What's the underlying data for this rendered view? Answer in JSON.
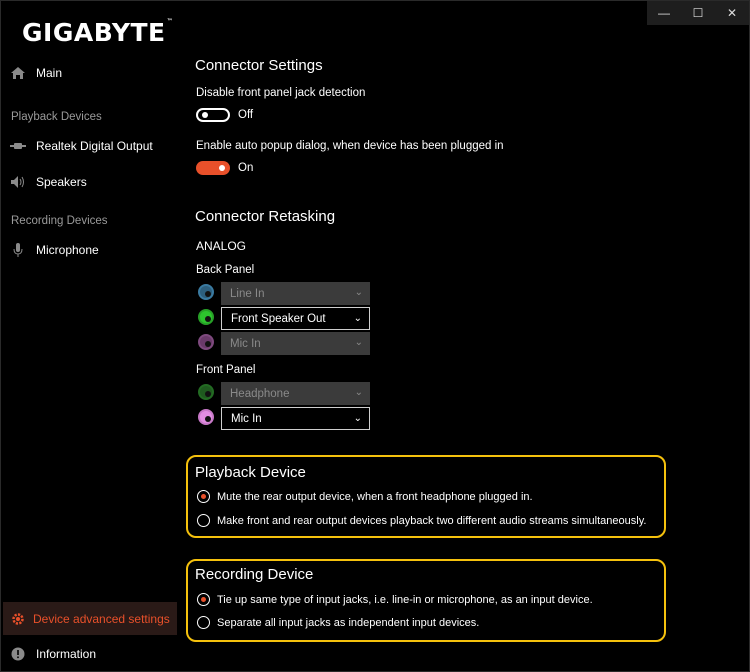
{
  "window": {
    "minimize": "—",
    "maximize": "☐",
    "close": "✕"
  },
  "brand": {
    "logo": "GIGABYTE",
    "tm": "™"
  },
  "sidebar": {
    "main": "Main",
    "playback_section": "Playback Devices",
    "realtek": "Realtek Digital Output",
    "speakers": "Speakers",
    "recording_section": "Recording Devices",
    "microphone": "Microphone",
    "advanced": "Device advanced settings",
    "information": "Information"
  },
  "connector_settings": {
    "title": "Connector Settings",
    "jack_detection_label": "Disable front panel jack detection",
    "jack_detection_state": "Off",
    "popup_label": "Enable auto popup dialog, when device has been plugged in",
    "popup_state": "On"
  },
  "retasking": {
    "title": "Connector Retasking",
    "analog": "ANALOG",
    "back_panel": "Back Panel",
    "back_jacks": [
      {
        "value": "Line In",
        "color": "#3a7aa0"
      },
      {
        "value": "Front Speaker Out",
        "color": "#2dc42d"
      },
      {
        "value": "Mic In",
        "color": "#7e4a7e"
      }
    ],
    "front_panel": "Front Panel",
    "front_jacks": [
      {
        "value": "Headphone",
        "color": "#236b23"
      },
      {
        "value": "Mic In",
        "color": "#e28ee2"
      }
    ]
  },
  "playback_device": {
    "title": "Playback Device",
    "option1": "Mute the rear output device, when a front headphone plugged in.",
    "option2": "Make front and rear output devices playback two different audio streams simultaneously."
  },
  "recording_device": {
    "title": "Recording Device",
    "option1": "Tie up same type of input jacks, i.e. line-in or microphone, as an input device.",
    "option2": "Separate all input jacks as independent input devices."
  },
  "colors": {
    "accent": "#e8502a",
    "highlight": "#f5c10d",
    "background": "#000000"
  }
}
